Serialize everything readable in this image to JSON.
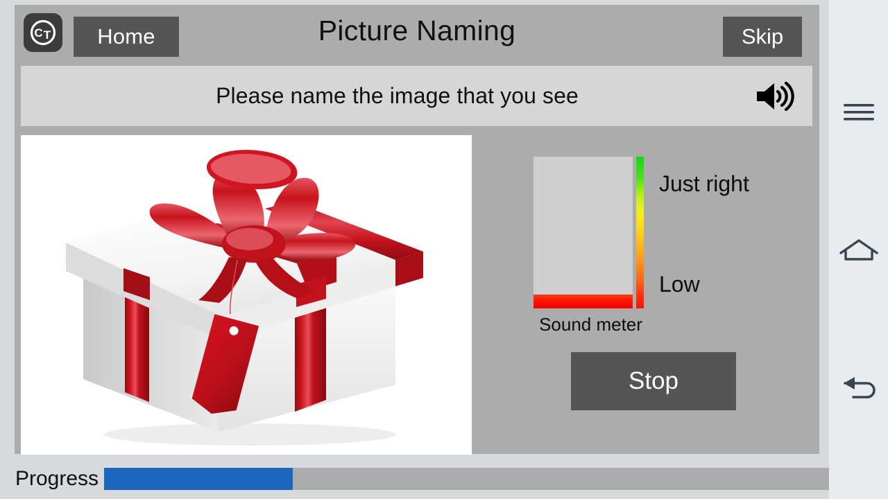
{
  "app": {
    "title": "Picture Naming",
    "logo_text": "CT",
    "logo_name": "constant-therapy-logo"
  },
  "header": {
    "home_label": "Home",
    "skip_label": "Skip"
  },
  "instruction": {
    "text": "Please name the image that you see",
    "speaker_icon": "speaker-volume-icon"
  },
  "picture": {
    "alt": "white gift box with red ribbon, bow and gift tag",
    "colors": {
      "box": "#ffffff",
      "ribbon": "#c8161d",
      "background": "#ffffff"
    }
  },
  "sound_meter": {
    "caption": "Sound meter",
    "high_label": "Just right",
    "low_label": "Low",
    "level_percent": 9,
    "level_color": "#f81409",
    "scale_top_color": "#17d617",
    "scale_mid_color": "#f6ef1b",
    "scale_bottom_color": "#f81409"
  },
  "controls": {
    "stop_label": "Stop"
  },
  "progress": {
    "label": "Progress",
    "percent": 26,
    "fill_color": "#1e65bd",
    "track_color": "#acacac"
  },
  "navbar": {
    "recents_icon": "menu-hamburger-icon",
    "home_icon": "home-outline-icon",
    "back_icon": "back-arrow-icon"
  }
}
